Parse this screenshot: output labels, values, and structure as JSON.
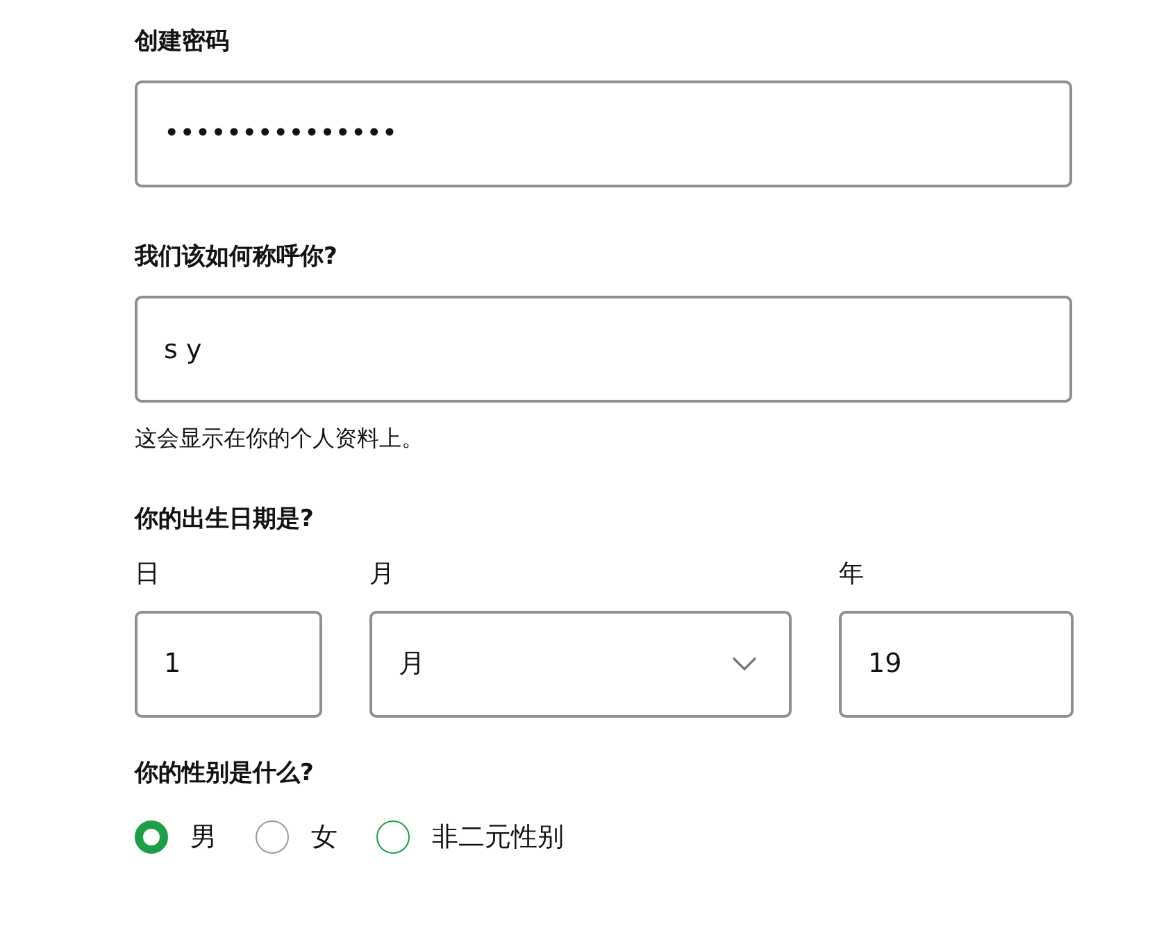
{
  "password": {
    "label": "创建密码",
    "value": "•••••••••••••••"
  },
  "name": {
    "label": "我们该如何称呼你?",
    "value": "s y",
    "hint": "这会显示在你的个人资料上。"
  },
  "birth_date": {
    "label": "你的出生日期是?",
    "fields": [
      {
        "kind": "text",
        "label": "日",
        "value": "1"
      },
      {
        "kind": "dropdown",
        "label": "月",
        "value": "月"
      },
      {
        "kind": "text",
        "label": "年",
        "value": "19"
      }
    ]
  },
  "gender": {
    "label": "你的性别是什么?",
    "options": [
      {
        "label": "男",
        "selected": true,
        "color": "#1e9e48"
      },
      {
        "label": "女",
        "selected": false,
        "color": "#9a9a9a"
      },
      {
        "label": "非二元性别",
        "selected": false,
        "color": "#1e9e48"
      }
    ]
  }
}
